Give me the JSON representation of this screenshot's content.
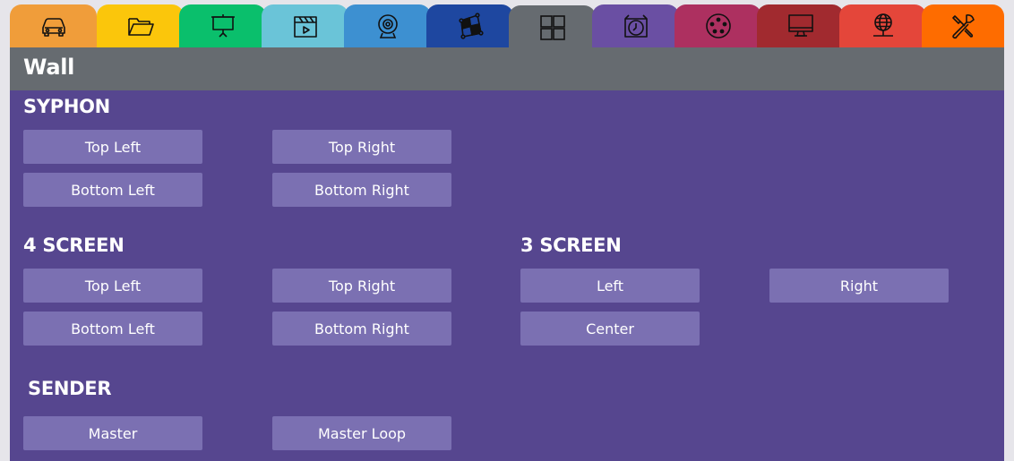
{
  "tabs": [
    {
      "icon": "car-icon",
      "color": "#f09d3a"
    },
    {
      "icon": "folder-icon",
      "color": "#fbc60b"
    },
    {
      "icon": "projector-screen-icon",
      "color": "#0abf6c"
    },
    {
      "icon": "clapperboard-icon",
      "color": "#6ac4d8"
    },
    {
      "icon": "webcam-icon",
      "color": "#3d90d1"
    },
    {
      "icon": "warp-grid-icon",
      "color": "#1e47a0"
    },
    {
      "icon": "grid-four-icon",
      "color": "#666b70",
      "active": true
    },
    {
      "icon": "timer-icon",
      "color": "#6a4fa3"
    },
    {
      "icon": "dmx-connector-icon",
      "color": "#ad3060"
    },
    {
      "icon": "monitor-icon",
      "color": "#a12a2f"
    },
    {
      "icon": "network-globe-icon",
      "color": "#e4463a"
    },
    {
      "icon": "tools-icon",
      "color": "#fe6c00"
    }
  ],
  "header": {
    "title": "Wall"
  },
  "sections": {
    "syphon": {
      "title": "SYPHON",
      "buttons": [
        "Top Left",
        "Top Right",
        "Bottom Left",
        "Bottom Right"
      ]
    },
    "four_screen": {
      "title": "4 SCREEN",
      "buttons": [
        "Top Left",
        "Top Right",
        "Bottom Left",
        "Bottom Right"
      ]
    },
    "three_screen": {
      "title": "3 SCREEN",
      "buttons": [
        "Left",
        "Right",
        "Center"
      ]
    },
    "sender": {
      "title": "SENDER",
      "buttons": [
        "Master",
        "Master Loop"
      ]
    }
  },
  "colors": {
    "header_bg": "#666b70",
    "content_bg": "#56468f",
    "button_bg": "#7b70b2",
    "page_bg": "#e6e5ea"
  }
}
